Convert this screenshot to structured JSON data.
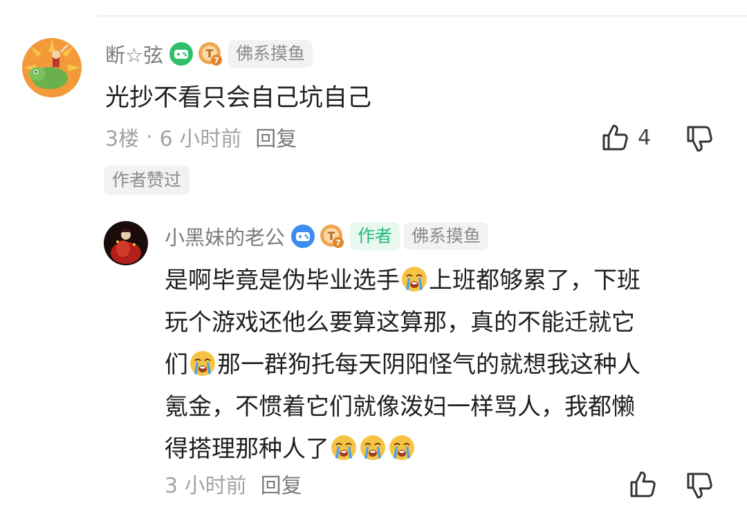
{
  "comments": [
    {
      "username": "断☆弦",
      "tag": "佛系摸鱼",
      "text": "光抄不看只会自己坑自己",
      "floor": "3楼",
      "separator": "·",
      "time": "6 小时前",
      "reply_label": "回复",
      "like_count": "4",
      "liked_by_author": "作者赞过"
    },
    {
      "username": "小黑妹的老公",
      "author_tag": "作者",
      "tag": "佛系摸鱼",
      "lines": [
        [
          "是啊毕竟是伪毕业选手",
          "emoji:loudly-crying-face",
          "上班都够累了，下班"
        ],
        [
          "玩个游戏还他么要算这算那，真的不能迁就它"
        ],
        [
          "们",
          "emoji:loudly-crying-face",
          "那一群狗托每天阴阳怪气的就想我这种人"
        ],
        [
          "氪金，不惯着它们就像泼妇一样骂人，我都懒"
        ],
        [
          "得搭理那种人了",
          "emoji:loudly-crying-face",
          "emoji:loudly-crying-face",
          "emoji:loudly-crying-face"
        ]
      ],
      "time": "3 小时前",
      "reply_label": "回复"
    }
  ],
  "colors": {
    "author_green": "#27b87f",
    "level_orange": "#f0a550",
    "game_badge_green": "#2fbf6b",
    "game_badge_blue": "#3c8df0"
  },
  "icons": [
    "thumbs-up-icon",
    "thumbs-down-icon",
    "gamepad-badge-icon",
    "level-t7-badge-icon",
    "loudly-crying-face-emoji"
  ]
}
